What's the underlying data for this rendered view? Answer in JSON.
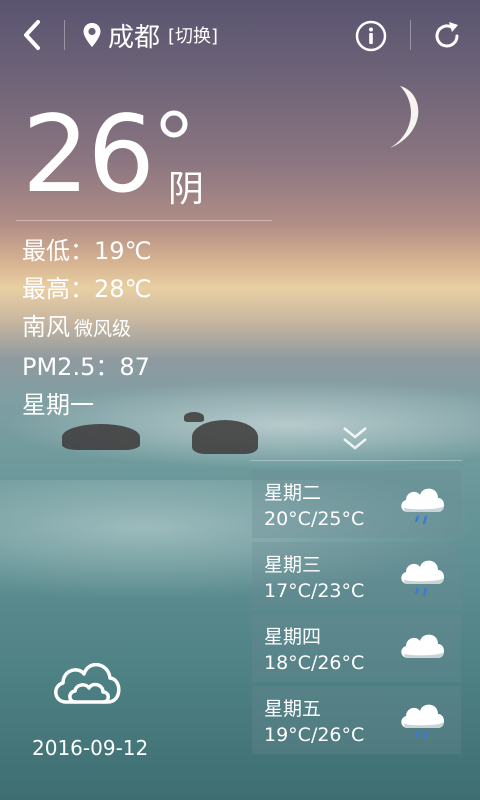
{
  "header": {
    "city": "成都",
    "switch_label": "[切换]"
  },
  "current": {
    "temperature": "26",
    "condition": "阴",
    "low": "最低：19℃",
    "high": "最高：28℃",
    "wind_direction": "南风",
    "wind_level": "微风级",
    "pm25": "PM2.5：87",
    "weekday": "星期一"
  },
  "forecast": [
    {
      "day": "星期二",
      "range": "20°C/25°C",
      "icon": "rain-cloud-icon"
    },
    {
      "day": "星期三",
      "range": "17°C/23°C",
      "icon": "rain-cloud-icon"
    },
    {
      "day": "星期四",
      "range": "18°C/26°C",
      "icon": "cloud-icon"
    },
    {
      "day": "星期五",
      "range": "19°C/26°C",
      "icon": "rain-cloud-icon"
    }
  ],
  "footer": {
    "date": "2016-09-12",
    "icon": "cloudy-outline-icon"
  },
  "icons": [
    "back-icon",
    "location-pin-icon",
    "info-icon",
    "refresh-icon",
    "moon-icon",
    "chevron-double-down-icon"
  ]
}
